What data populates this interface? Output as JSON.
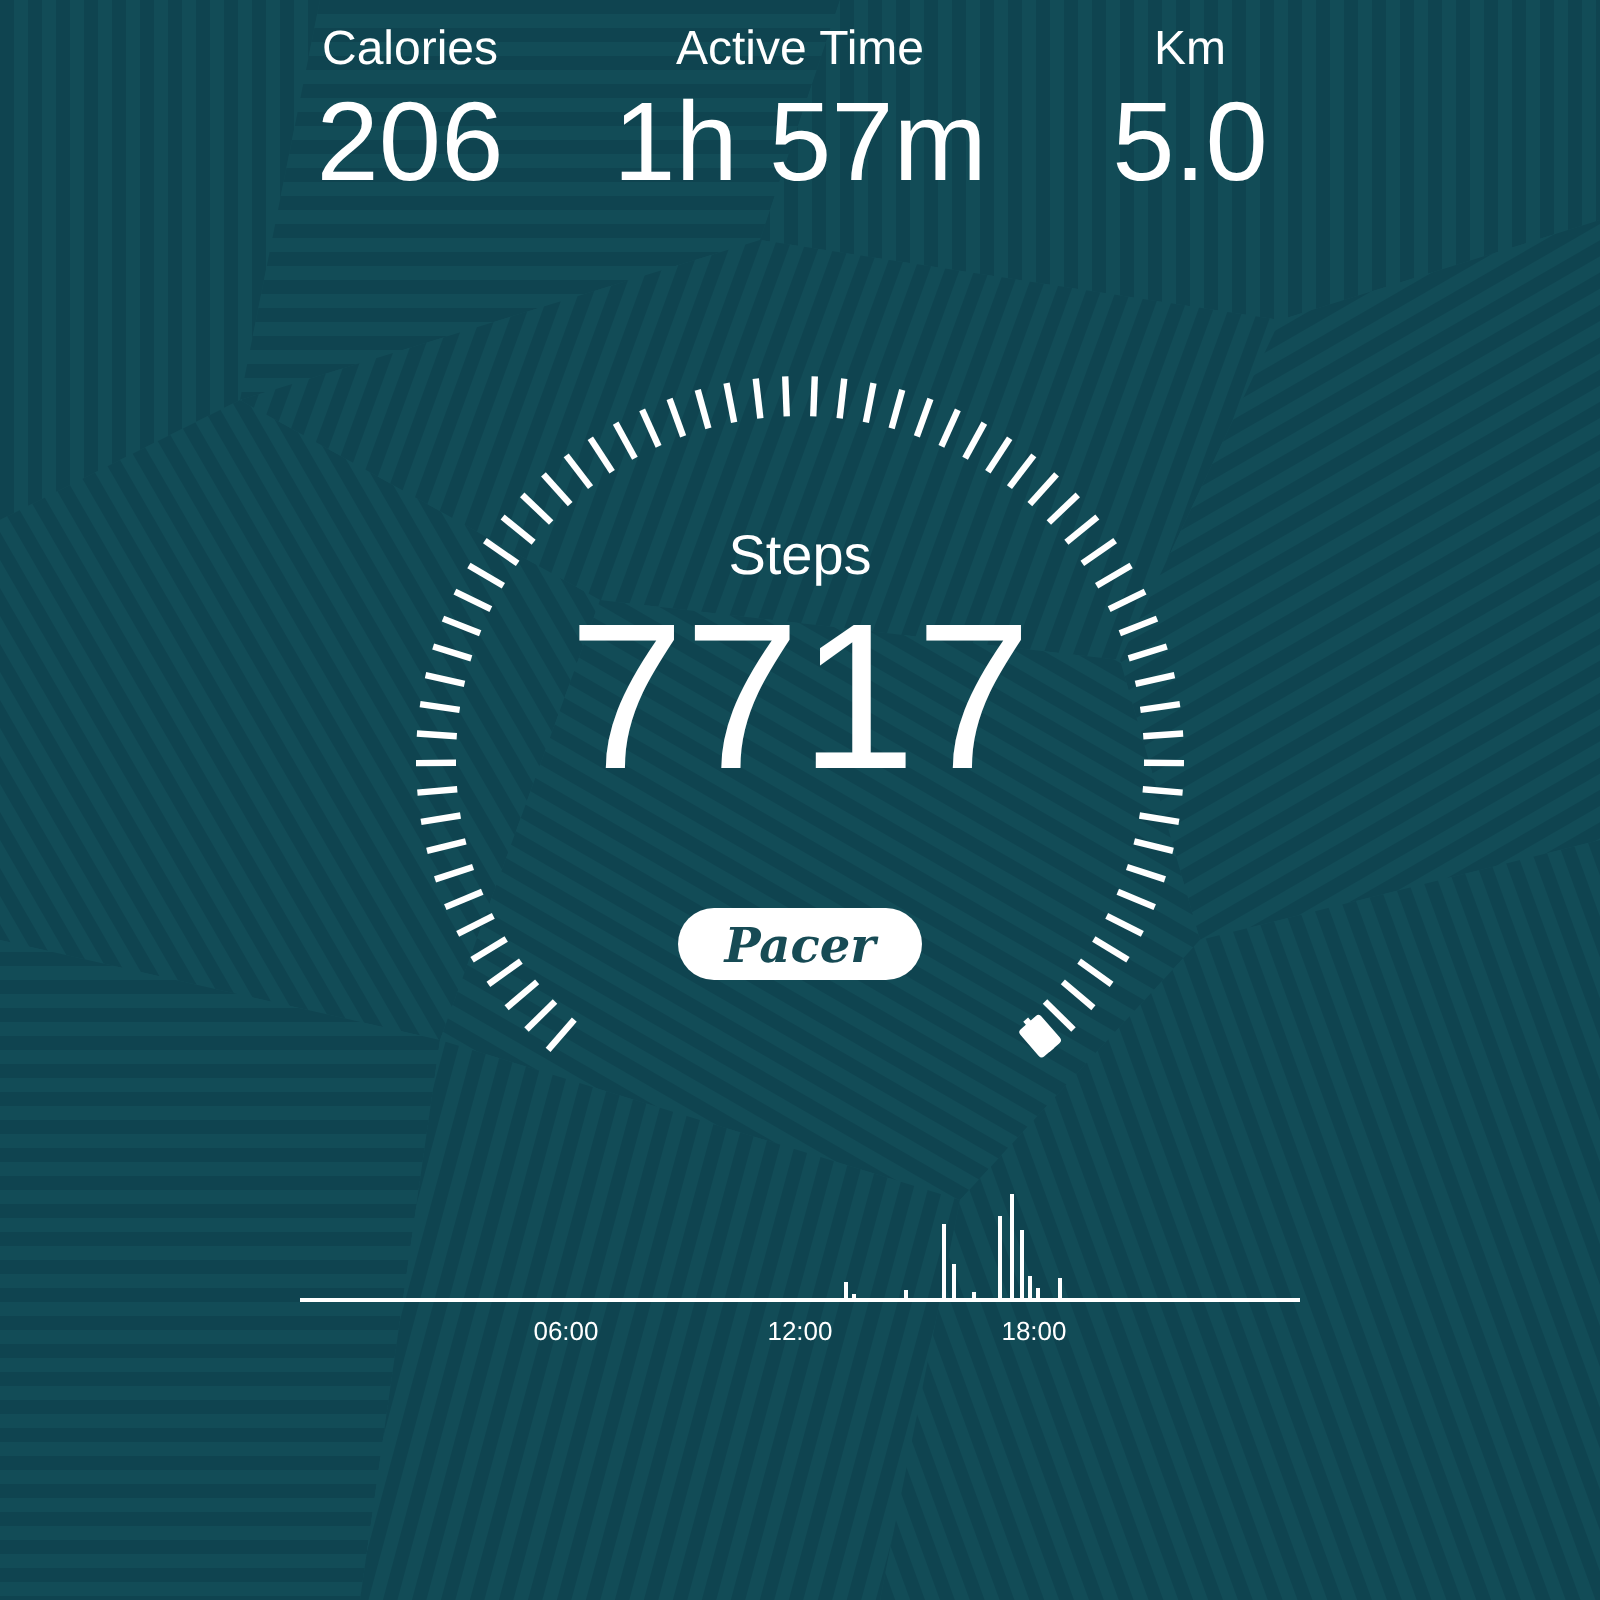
{
  "stats": [
    {
      "label": "Calories",
      "value": "206"
    },
    {
      "label": "Active Time",
      "value": "1h 57m"
    },
    {
      "label": "Km",
      "value": "5.0"
    }
  ],
  "gauge": {
    "label": "Steps",
    "value": "7717"
  },
  "logo": "Pacer",
  "timeline": {
    "xticks": [
      "06:00",
      "12:00",
      "18:00"
    ]
  }
}
